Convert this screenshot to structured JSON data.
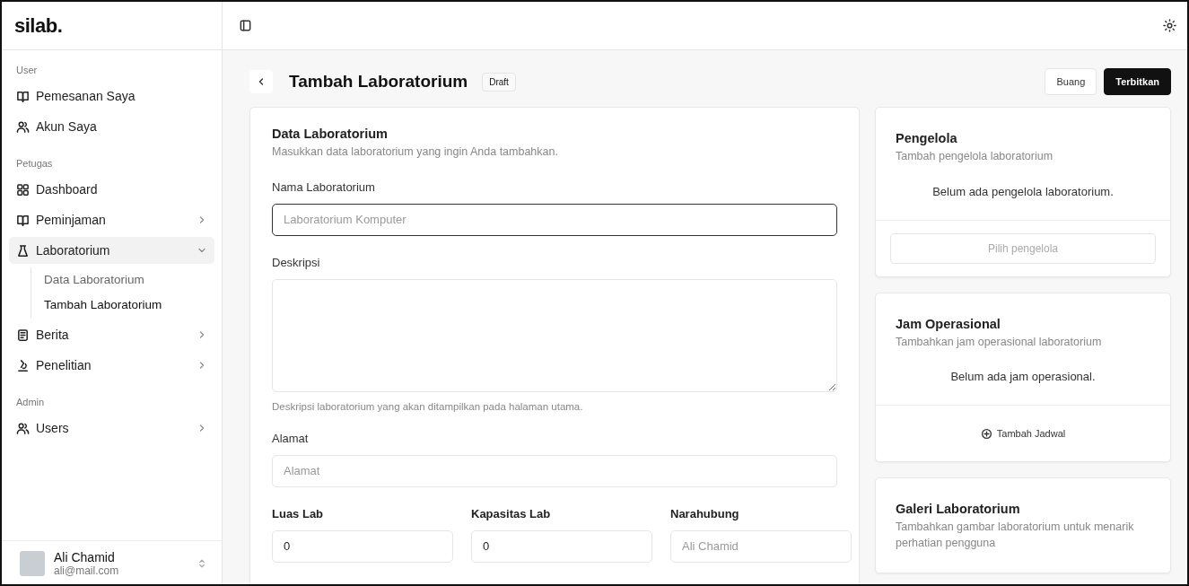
{
  "logo": "silab.",
  "sidebar": {
    "sections": [
      {
        "label": "User",
        "items": [
          {
            "label": "Pemesanan Saya",
            "kind": "book",
            "selected": false
          },
          {
            "label": "Akun Saya",
            "kind": "users",
            "selected": false
          }
        ]
      },
      {
        "label": "Petugas",
        "items": [
          {
            "label": "Dashboard",
            "kind": "grid",
            "selected": false
          },
          {
            "label": "Peminjaman",
            "kind": "book",
            "selected": false,
            "expanded": false
          },
          {
            "label": "Laboratorium",
            "kind": "flask",
            "selected": true,
            "expanded": true,
            "children": [
              {
                "label": "Data Laboratorium",
                "selected": false
              },
              {
                "label": "Tambah Laboratorium",
                "selected": true
              }
            ]
          },
          {
            "label": "Berita",
            "kind": "news",
            "selected": false,
            "expanded": false
          },
          {
            "label": "Penelitian",
            "kind": "microscope",
            "selected": false,
            "expanded": false
          }
        ]
      },
      {
        "label": "Admin",
        "items": [
          {
            "label": "Users",
            "kind": "users",
            "selected": false,
            "expanded": false
          }
        ]
      }
    ],
    "user": {
      "name": "Ali Chamid",
      "email": "ali@mail.com"
    }
  },
  "header": {
    "title": "Tambah Laboratorium",
    "badge": "Draft",
    "buttons": [
      {
        "label": "Buang",
        "kind": "outline"
      },
      {
        "label": "Terbitkan",
        "kind": "primary"
      }
    ]
  },
  "form": {
    "title": "Data Laboratorium",
    "subtitle": "Masukkan data laboratorium yang ingin Anda tambahkan.",
    "fields": [
      {
        "label": "Nama Laboratorium",
        "kind": "input",
        "placeholder": "Laboratorium Komputer",
        "focused": true
      },
      {
        "label": "Deskripsi",
        "kind": "textarea",
        "hint": "Deskripsi laboratorium yang akan ditampilkan pada halaman utama.",
        "focused": false
      },
      {
        "label": "Alamat",
        "kind": "input",
        "placeholder": "Alamat",
        "focused": false
      }
    ],
    "row": [
      {
        "label": "Luas Lab",
        "value": "0"
      },
      {
        "label": "Kapasitas Lab",
        "value": "0"
      },
      {
        "label": "Narahubung",
        "placeholder": "Ali Chamid"
      }
    ]
  },
  "cards": [
    {
      "title": "Pengelola",
      "subtitle": "Tambah pengelola laboratorium",
      "empty": "Belum ada pengelola laboratorium.",
      "action": {
        "label": "Pilih pengelola",
        "kind": "disabled"
      }
    },
    {
      "title": "Jam Operasional",
      "subtitle": "Tambahkan jam operasional laboratorium",
      "empty": "Belum ada jam operasional.",
      "action": {
        "label": "Tambah Jadwal",
        "kind": "add"
      }
    },
    {
      "title": "Galeri Laboratorium",
      "subtitle": "Tambahkan gambar laboratorium untuk menarik perhatian pengguna"
    }
  ]
}
